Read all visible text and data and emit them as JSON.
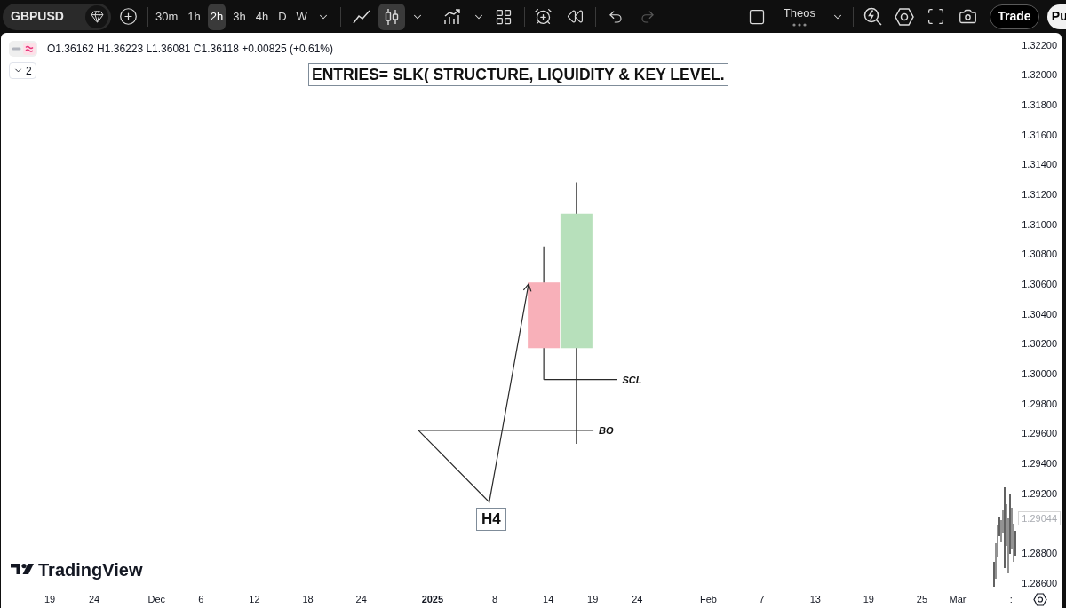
{
  "toolbar": {
    "symbol": "GBPUSD",
    "intervals": [
      {
        "label": "30m",
        "selected": false
      },
      {
        "label": "1h",
        "selected": false
      },
      {
        "label": "2h",
        "selected": true
      },
      {
        "label": "3h",
        "selected": false
      },
      {
        "label": "4h",
        "selected": false
      },
      {
        "label": "D",
        "selected": false
      },
      {
        "label": "W",
        "selected": false
      }
    ],
    "chart_styles": [
      {
        "kind": "line",
        "selected": false
      },
      {
        "kind": "candles",
        "selected": true
      }
    ],
    "layout_name": "Theos",
    "buttons": [
      {
        "label": "Trade",
        "kind": "outline"
      },
      {
        "label": "Pu",
        "kind": "filled"
      }
    ]
  },
  "chart": {
    "legend": {
      "ohlc_values": "O1.36162 H1.36223 L1.36081 C1.36118 +0.00825 (+0.61%)",
      "collapse_count": "2"
    },
    "branding": "TradingView",
    "last_price_label": "1.29044",
    "chart_data": [
      {
        "type": "candlestick",
        "title": "ENTRIES= SLK( STRUCTURE, LIQUIDITY & KEY LEVEL.",
        "xlim": [
          "2024-11-19",
          "2025-03-07"
        ],
        "ylim": [
          1.286,
          1.322
        ],
        "xticks": [
          {
            "value": "2024-11-19",
            "label": "19"
          },
          {
            "value": "2024-11-24",
            "label": "24"
          },
          {
            "value": "2024-12-01",
            "label": "Dec"
          },
          {
            "value": "2024-12-06",
            "label": "6"
          },
          {
            "value": "2024-12-12",
            "label": "12"
          },
          {
            "value": "2024-12-18",
            "label": "18"
          },
          {
            "value": "2024-12-24",
            "label": "24"
          },
          {
            "value": "2025-01-01",
            "label": "2025"
          },
          {
            "value": "2025-01-08",
            "label": "8"
          },
          {
            "value": "2025-01-14",
            "label": "14"
          },
          {
            "value": "2025-01-19",
            "label": "19"
          },
          {
            "value": "2025-01-24",
            "label": "24"
          },
          {
            "value": "2025-02-01",
            "label": "Feb"
          },
          {
            "value": "2025-02-07",
            "label": "7"
          },
          {
            "value": "2025-02-13",
            "label": "13"
          },
          {
            "value": "2025-02-19",
            "label": "19"
          },
          {
            "value": "2025-02-25",
            "label": "25"
          },
          {
            "value": "2025-03-01",
            "label": "Mar"
          },
          {
            "value": "2025-03-07",
            "label": ":"
          }
        ],
        "yticks": [
          {
            "value": 1.322,
            "label": "1.32200"
          },
          {
            "value": 1.32,
            "label": "1.32000"
          },
          {
            "value": 1.318,
            "label": "1.31800"
          },
          {
            "value": 1.316,
            "label": "1.31600"
          },
          {
            "value": 1.314,
            "label": "1.31400"
          },
          {
            "value": 1.312,
            "label": "1.31200"
          },
          {
            "value": 1.31,
            "label": "1.31000"
          },
          {
            "value": 1.308,
            "label": "1.30800"
          },
          {
            "value": 1.306,
            "label": "1.30600"
          },
          {
            "value": 1.304,
            "label": "1.30400"
          },
          {
            "value": 1.302,
            "label": "1.30200"
          },
          {
            "value": 1.3,
            "label": "1.30000"
          },
          {
            "value": 1.298,
            "label": "1.29800"
          },
          {
            "value": 1.296,
            "label": "1.29600"
          },
          {
            "value": 1.294,
            "label": "1.29400"
          },
          {
            "value": 1.292,
            "label": "1.29200"
          },
          {
            "value": 1.288,
            "label": "1.28800"
          },
          {
            "value": 1.286,
            "label": "1.28600"
          }
        ],
        "series": [
          {
            "type": "candlestick",
            "x": [
              "2025-01-13T12:00",
              "2025-01-17T04:00"
            ],
            "ohlc": [
              [
                1.3061,
                1.3085,
                1.2996,
                1.3017
              ],
              [
                1.3017,
                1.3128,
                1.2953,
                1.3107
              ]
            ]
          },
          {
            "type": "line",
            "x": [
              "2024-12-30T10:00",
              "2025-01-07T09:00",
              "2025-01-11T19:00"
            ],
            "values": [
              1.2962,
              1.2914,
              1.306
            ]
          },
          {
            "type": "line",
            "name": "SCL",
            "x": [
              "2025-01-13T12:00",
              "2025-01-21T17:00"
            ],
            "values": [
              1.2996,
              1.2996
            ]
          },
          {
            "type": "line",
            "name": "BO",
            "x": [
              "2024-12-30T10:00",
              "2025-01-19T02:00"
            ],
            "values": [
              1.2962,
              1.2962
            ]
          }
        ],
        "annotations": [
          "H4"
        ]
      }
    ]
  }
}
